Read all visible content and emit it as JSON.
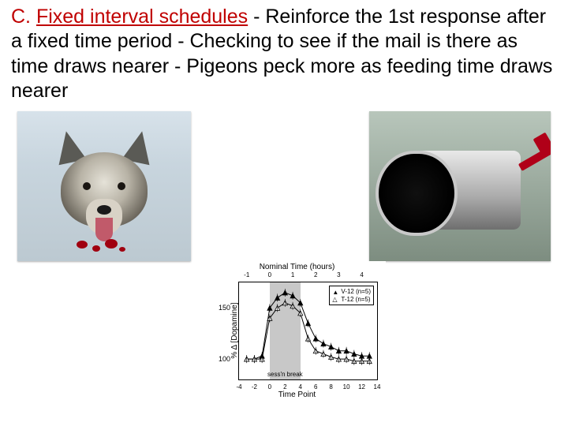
{
  "heading": {
    "lead_letter": "C.",
    "lead_term": "Fixed interval schedules",
    "rest": " - Reinforce the 1st response after a fixed time period - Checking to see if the mail is there as time draws nearer - Pigeons peck more as feeding time draws nearer"
  },
  "images": {
    "wolf_alt": "wolf-with-blood-on-snout",
    "mailbox_alt": "open-empty-mailbox",
    "chart_alt": "dopamine-vs-time-point-chart"
  },
  "chart_data": {
    "type": "line",
    "title": "Nominal Time (hours)",
    "xlabel": "Time Point",
    "ylabel": "% Δ [Dopamine]",
    "x_top_ticks": [
      -1,
      0,
      1,
      2,
      3,
      4
    ],
    "x_bottom_ticks": [
      -4,
      -2,
      0,
      2,
      4,
      6,
      8,
      10,
      12,
      14
    ],
    "y_ticks": [
      100,
      150
    ],
    "ylim": [
      80,
      175
    ],
    "xlim": [
      -4,
      14
    ],
    "shaded_x": [
      0,
      4
    ],
    "session_break_label": "sess'n break",
    "session_break_x": 2,
    "legend": [
      {
        "name": "V-12 (n=5)",
        "marker": "triangle",
        "color": "#000"
      },
      {
        "name": "T-12 (n=5)",
        "marker": "triangle-open",
        "color": "#000"
      }
    ],
    "series": [
      {
        "name": "V-12 (n=5)",
        "x": [
          -3,
          -2,
          -1,
          0,
          1,
          2,
          3,
          4,
          5,
          6,
          7,
          8,
          9,
          10,
          11,
          12,
          13
        ],
        "y": [
          100,
          100,
          103,
          150,
          160,
          165,
          162,
          155,
          135,
          120,
          115,
          112,
          108,
          108,
          105,
          103,
          103
        ]
      },
      {
        "name": "T-12 (n=5)",
        "x": [
          -3,
          -2,
          -1,
          0,
          1,
          2,
          3,
          4,
          5,
          6,
          7,
          8,
          9,
          10,
          11,
          12,
          13
        ],
        "y": [
          100,
          100,
          100,
          140,
          150,
          155,
          152,
          145,
          120,
          108,
          105,
          102,
          100,
          100,
          98,
          98,
          98
        ]
      }
    ]
  }
}
